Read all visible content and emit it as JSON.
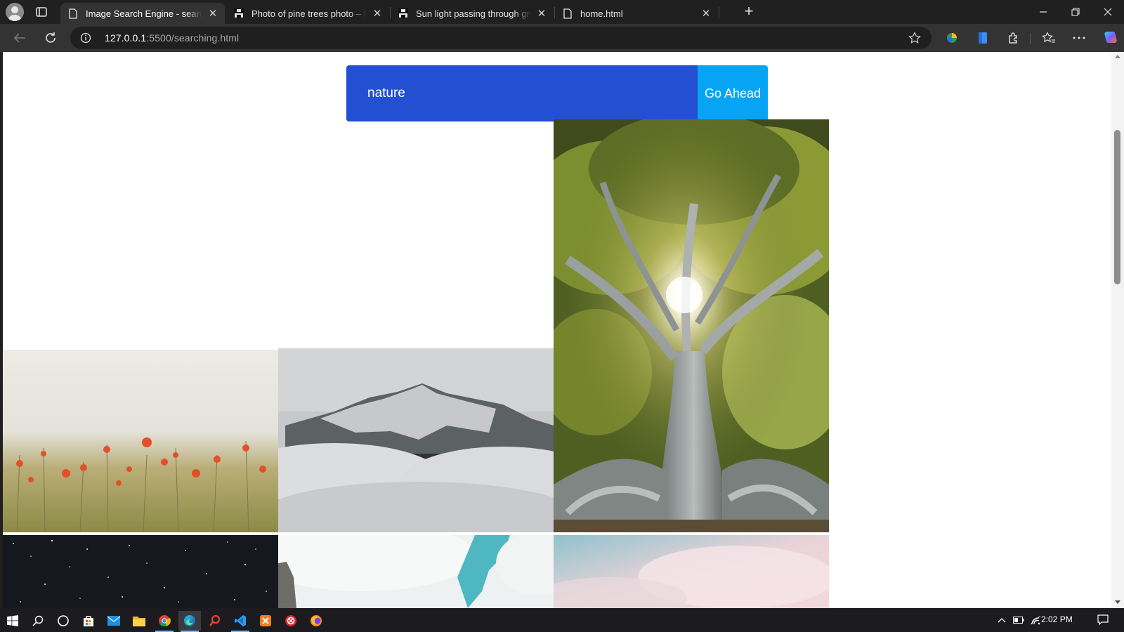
{
  "browser": {
    "tabs": [
      {
        "title": "Image Search Engine - searching",
        "icon": "page-icon",
        "active": true
      },
      {
        "title": "Photo of pine trees photo – Free",
        "icon": "unsplash-icon",
        "active": false
      },
      {
        "title": "Sun light passing through green l",
        "icon": "unsplash-icon",
        "active": false
      },
      {
        "title": "home.html",
        "icon": "page-icon",
        "active": false
      }
    ],
    "address": {
      "host": "127.0.0.1",
      "path": ":5500/searching.html"
    }
  },
  "page": {
    "search": {
      "value": "nature",
      "button_label": "Go Ahead"
    },
    "results": [
      {
        "name": "tree-with-sun-image",
        "description": "sunlight through large tree canopy"
      },
      {
        "name": "poppy-field-image",
        "description": "red poppies in wheat field"
      },
      {
        "name": "misty-mountain-image",
        "description": "snowy mountain above clouds"
      },
      {
        "name": "starry-sky-image",
        "description": "night sky with stars"
      },
      {
        "name": "cliff-sky-image",
        "description": "rock cliff and blue sky"
      },
      {
        "name": "pastel-clouds-image",
        "description": "pink and blue cloudy sky"
      }
    ]
  },
  "taskbar": {
    "apps": [
      "start-icon",
      "search-icon",
      "task-view-icon",
      "store-icon",
      "mail-icon",
      "file-explorer-icon",
      "chrome-icon",
      "edge-icon",
      "search-app-icon",
      "vscode-icon",
      "xampp-icon",
      "app-icon",
      "firefox-icon"
    ],
    "clock": "2:02 PM"
  },
  "colors": {
    "search_bg": "#234fd2",
    "button_bg": "#08a4f4",
    "browser_dark": "#202020",
    "toolbar": "#333333"
  }
}
